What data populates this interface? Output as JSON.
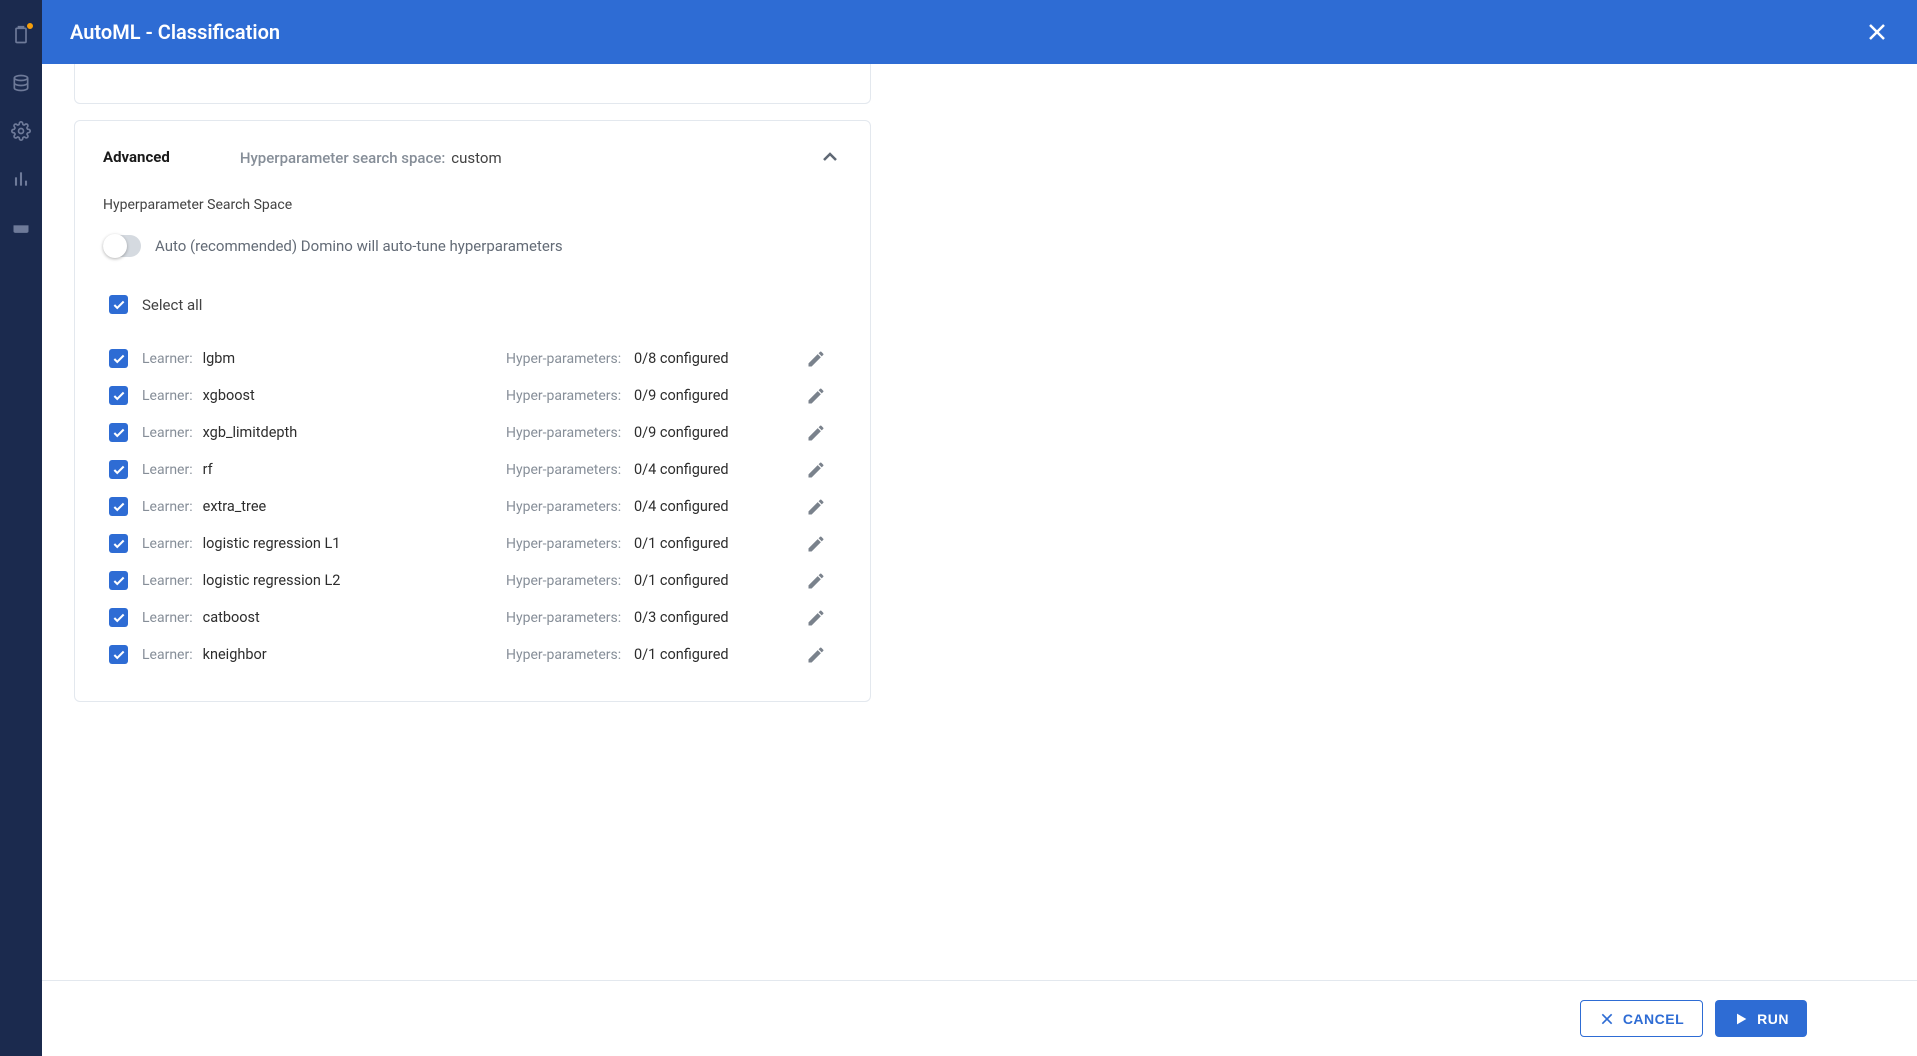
{
  "header": {
    "title": "AutoML - Classification"
  },
  "advanced": {
    "label": "Advanced",
    "hps_label": "Hyperparameter search space:",
    "hps_value": "custom",
    "sub_label": "Hyperparameter Search Space",
    "toggle_label": "Auto (recommended) Domino will auto-tune hyperparameters",
    "select_all_label": "Select all",
    "learner_key": "Learner:",
    "hp_key": "Hyper-parameters:",
    "learners": [
      {
        "name": "lgbm",
        "configured": "0/8 configured"
      },
      {
        "name": "xgboost",
        "configured": "0/9 configured"
      },
      {
        "name": "xgb_limitdepth",
        "configured": "0/9 configured"
      },
      {
        "name": "rf",
        "configured": "0/4 configured"
      },
      {
        "name": "extra_tree",
        "configured": "0/4 configured"
      },
      {
        "name": "logistic regression L1",
        "configured": "0/1 configured"
      },
      {
        "name": "logistic regression L2",
        "configured": "0/1 configured"
      },
      {
        "name": "catboost",
        "configured": "0/3 configured"
      },
      {
        "name": "kneighbor",
        "configured": "0/1 configured"
      }
    ]
  },
  "footer": {
    "cancel": "CANCEL",
    "run": "RUN"
  }
}
